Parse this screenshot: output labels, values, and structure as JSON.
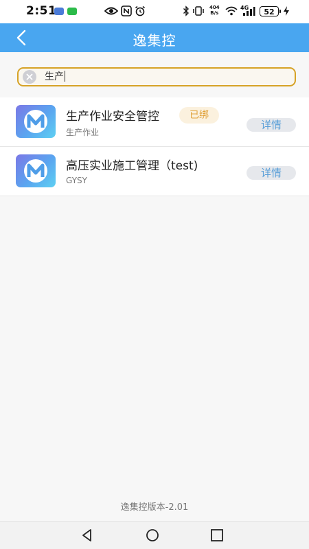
{
  "status_bar": {
    "time": "2:51",
    "net_speed_value": "404",
    "net_speed_unit": "B/s",
    "network_type": "4G",
    "battery_level": "52"
  },
  "header": {
    "title": "逸集控",
    "back_icon": "chevron-left-icon"
  },
  "search": {
    "value": "生产",
    "clear_icon": "clear-icon"
  },
  "list": {
    "items": [
      {
        "title": "生产作业安全管控",
        "subtitle": "生产作业",
        "badge": "已绑",
        "detail_label": "详情"
      },
      {
        "title": "高压实业施工管理（test)",
        "subtitle": "GYSY",
        "detail_label": "详情"
      }
    ]
  },
  "footer": {
    "version": "逸集控版本-2.01"
  },
  "colors": {
    "header_bg": "#49a6f0",
    "search_border": "#d6a226",
    "badge_text": "#e0a13a",
    "detail_text": "#5a9fd8"
  },
  "nav_bar": {
    "back_icon": "triangle-back-icon",
    "home_icon": "circle-home-icon",
    "recents_icon": "square-recents-icon"
  }
}
